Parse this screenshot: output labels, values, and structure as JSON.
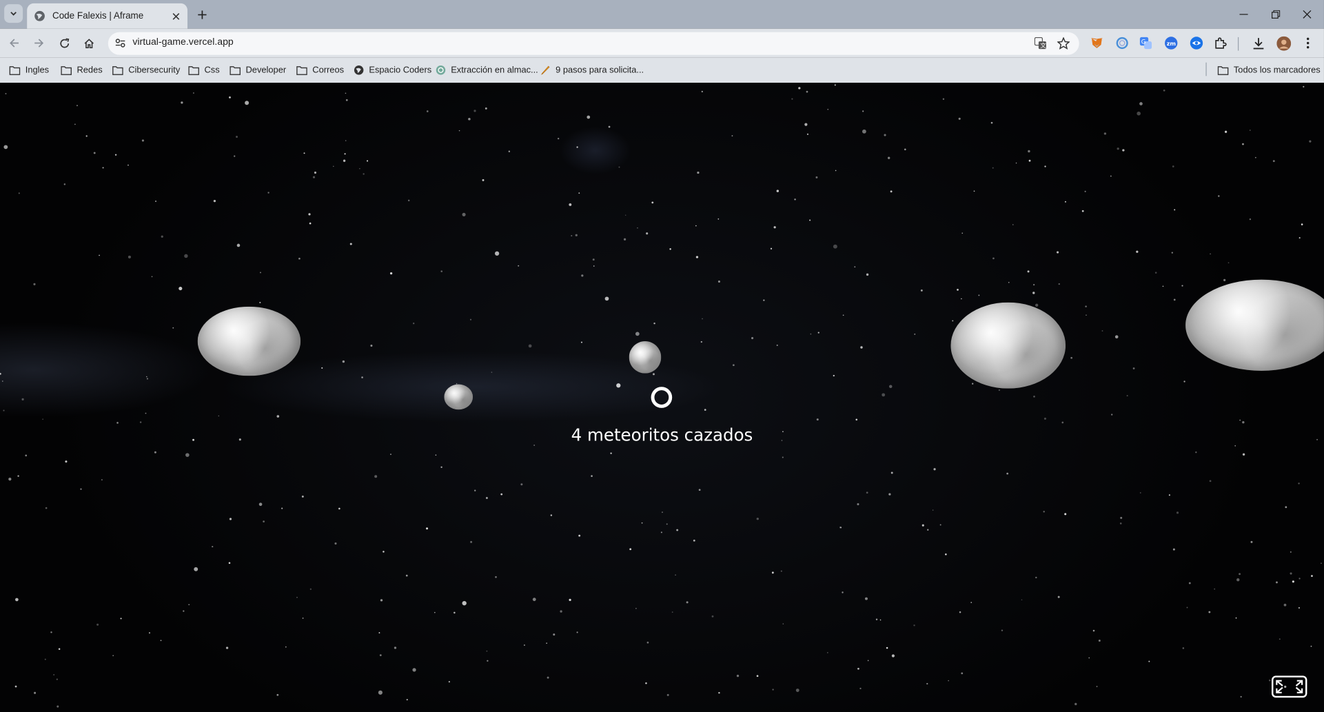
{
  "browser": {
    "tab": {
      "title": "Code Falexis | Aframe"
    },
    "address_bar": {
      "url": "virtual-game.vercel.app"
    },
    "bookmarks": [
      {
        "label": "Ingles",
        "icon": "folder-icon"
      },
      {
        "label": "Redes",
        "icon": "folder-icon"
      },
      {
        "label": "Cibersecurity",
        "icon": "folder-icon"
      },
      {
        "label": "Css",
        "icon": "folder-icon"
      },
      {
        "label": "Developer",
        "icon": "folder-icon"
      },
      {
        "label": "Correos",
        "icon": "folder-icon"
      },
      {
        "label": "Espacio Coders",
        "icon": "globe-icon"
      },
      {
        "label": "Extracción en almac...",
        "icon": "chatgpt-icon"
      },
      {
        "label": "9 pasos para solicita...",
        "icon": "pencil-icon"
      }
    ],
    "all_bookmarks_label": "Todos los marcadores"
  },
  "game": {
    "score_text": "4 meteoritos cazados",
    "colors": {
      "background": "#000000",
      "text": "#ffffff",
      "meteor": "#d9d9d9"
    }
  }
}
